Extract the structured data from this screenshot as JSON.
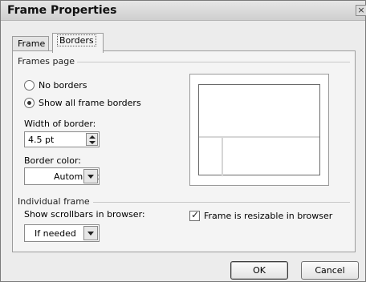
{
  "window": {
    "title": "Frame Properties",
    "close_glyph": "×"
  },
  "tabs": [
    {
      "label": "Frame",
      "active": false
    },
    {
      "label": "Borders",
      "active": true
    }
  ],
  "frames_page": {
    "group_label": "Frames page",
    "radio_no_borders": {
      "label": "No borders",
      "selected": false
    },
    "radio_show_borders": {
      "label": "Show all frame borders",
      "selected": true
    },
    "width_label": "Width of border:",
    "width_value": "4.5 pt",
    "color_label": "Border color:",
    "color_value": "Automatic"
  },
  "individual_frame": {
    "group_label": "Individual frame",
    "scrollbars_label": "Show scrollbars in browser:",
    "scrollbars_value": "If needed",
    "resizable_label": "Frame is resizable in browser",
    "resizable_checked": true,
    "check_glyph": "✓"
  },
  "buttons": {
    "ok": "OK",
    "cancel": "Cancel"
  },
  "colors": {
    "dialog_bg": "#ececec",
    "panel_bg": "#f4f4f4",
    "border": "#9c9c9c"
  }
}
